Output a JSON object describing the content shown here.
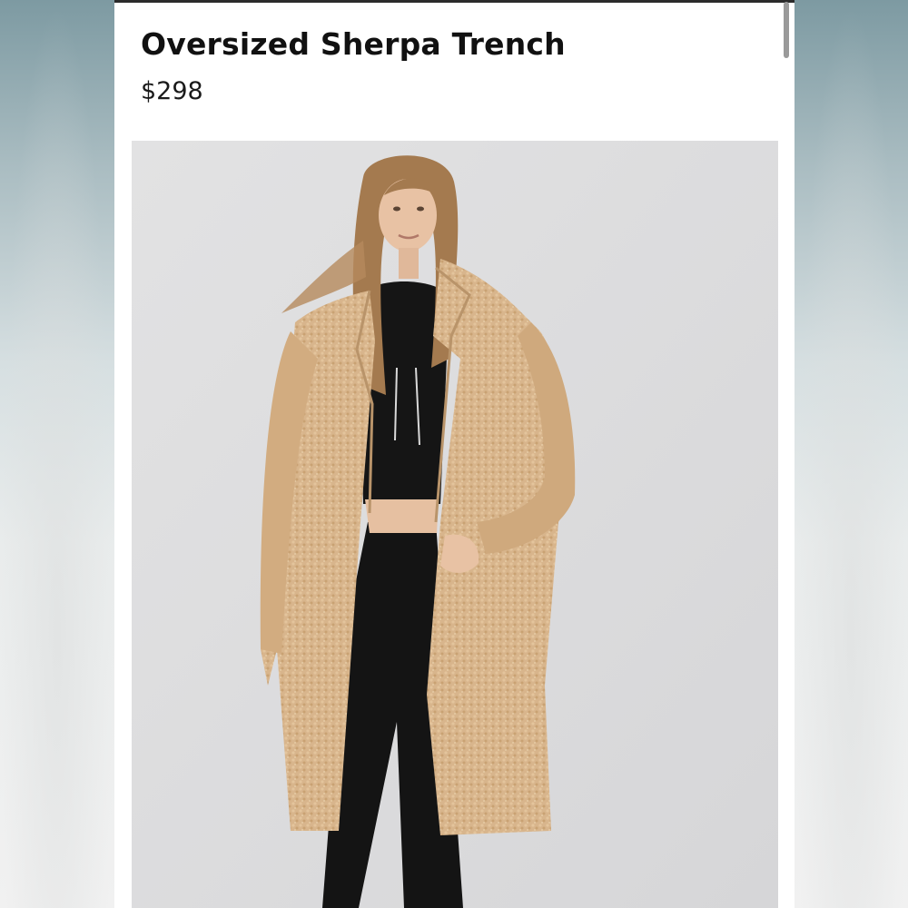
{
  "product": {
    "title": "Oversized Sherpa Trench",
    "price": "$298"
  },
  "image": {
    "subject": "product-photo",
    "colors": {
      "coat": "#d8b58c",
      "backdrop": "#dcdcdd",
      "outfit": "#141414",
      "hair": "#b58a5c",
      "skin": "#e8c2a4"
    }
  }
}
